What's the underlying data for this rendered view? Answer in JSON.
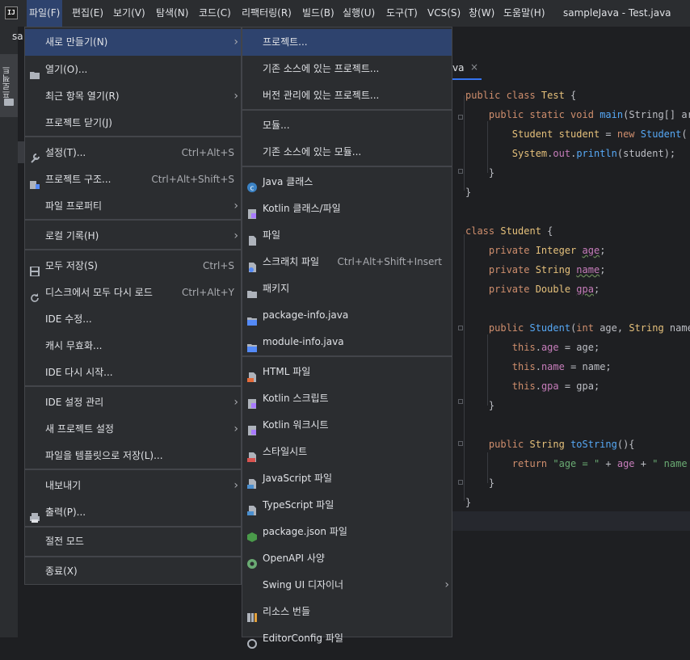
{
  "app_logo": "IJ",
  "menubar": [
    "파일(F)",
    "편집(E)",
    "보기(V)",
    "탐색(N)",
    "코드(C)",
    "리팩터링(R)",
    "빌드(B)",
    "실행(U)",
    "도구(T)",
    "VCS(S)",
    "창(W)",
    "도움말(H)"
  ],
  "window_title": "sampleJava - Test.java",
  "sidebar": {
    "stripe_label": "프로젝트",
    "project_name": "sa"
  },
  "editor_tab": {
    "label": "va",
    "close": "×"
  },
  "file_menu": [
    {
      "label": "새로 만들기(N)",
      "shortcut": "",
      "submenu": true,
      "icon": ""
    },
    {
      "label": "열기(O)...",
      "shortcut": "",
      "submenu": false,
      "icon": "folder-icon"
    },
    {
      "label": "최근 항목 열기(R)",
      "shortcut": "",
      "submenu": true,
      "icon": ""
    },
    {
      "label": "프로젝트 닫기(J)",
      "shortcut": "",
      "submenu": false,
      "icon": ""
    },
    {
      "label": "설정(T)...",
      "shortcut": "Ctrl+Alt+S",
      "submenu": false,
      "icon": "wrench-icon"
    },
    {
      "label": "프로젝트 구조...",
      "shortcut": "Ctrl+Alt+Shift+S",
      "submenu": false,
      "icon": "project-structure-icon"
    },
    {
      "label": "파일 프로퍼티",
      "shortcut": "",
      "submenu": true,
      "icon": ""
    },
    {
      "label": "로컬 기록(H)",
      "shortcut": "",
      "submenu": true,
      "icon": ""
    },
    {
      "label": "모두 저장(S)",
      "shortcut": "Ctrl+S",
      "submenu": false,
      "icon": "save-icon"
    },
    {
      "label": "디스크에서 모두 다시 로드",
      "shortcut": "Ctrl+Alt+Y",
      "submenu": false,
      "icon": "reload-icon"
    },
    {
      "label": "IDE 수정...",
      "shortcut": "",
      "submenu": false,
      "icon": ""
    },
    {
      "label": "캐시 무효화...",
      "shortcut": "",
      "submenu": false,
      "icon": ""
    },
    {
      "label": "IDE 다시 시작...",
      "shortcut": "",
      "submenu": false,
      "icon": ""
    },
    {
      "label": "IDE 설정 관리",
      "shortcut": "",
      "submenu": true,
      "icon": ""
    },
    {
      "label": "새 프로젝트 설정",
      "shortcut": "",
      "submenu": true,
      "icon": ""
    },
    {
      "label": "파일을 템플릿으로 저장(L)...",
      "shortcut": "",
      "submenu": false,
      "icon": ""
    },
    {
      "label": "내보내기",
      "shortcut": "",
      "submenu": true,
      "icon": ""
    },
    {
      "label": "출력(P)...",
      "shortcut": "",
      "submenu": false,
      "icon": "print-icon"
    },
    {
      "label": "절전 모드",
      "shortcut": "",
      "submenu": false,
      "icon": ""
    },
    {
      "label": "종료(X)",
      "shortcut": "",
      "submenu": false,
      "icon": ""
    }
  ],
  "new_menu": [
    {
      "label": "프로젝트...",
      "shortcut": "",
      "submenu": false,
      "icon": ""
    },
    {
      "label": "기존 소스에 있는 프로젝트...",
      "shortcut": "",
      "submenu": false,
      "icon": ""
    },
    {
      "label": "버전 관리에 있는 프로젝트...",
      "shortcut": "",
      "submenu": false,
      "icon": ""
    },
    {
      "label": "모듈...",
      "shortcut": "",
      "submenu": false,
      "icon": ""
    },
    {
      "label": "기존 소스에 있는 모듈...",
      "shortcut": "",
      "submenu": false,
      "icon": ""
    },
    {
      "label": "Java 클래스",
      "shortcut": "",
      "submenu": false,
      "icon": "java-class-icon"
    },
    {
      "label": "Kotlin 클래스/파일",
      "shortcut": "",
      "submenu": false,
      "icon": "kotlin-file-icon"
    },
    {
      "label": "파일",
      "shortcut": "",
      "submenu": false,
      "icon": "file-icon"
    },
    {
      "label": "스크래치 파일",
      "shortcut": "Ctrl+Alt+Shift+Insert",
      "submenu": false,
      "icon": "scratch-file-icon"
    },
    {
      "label": "패키지",
      "shortcut": "",
      "submenu": false,
      "icon": "package-folder-icon"
    },
    {
      "label": "package-info.java",
      "shortcut": "",
      "submenu": false,
      "icon": "package-info-icon"
    },
    {
      "label": "module-info.java",
      "shortcut": "",
      "submenu": false,
      "icon": "module-info-icon"
    },
    {
      "label": "HTML 파일",
      "shortcut": "",
      "submenu": false,
      "icon": "html-file-icon"
    },
    {
      "label": "Kotlin 스크립트",
      "shortcut": "",
      "submenu": false,
      "icon": "kotlin-script-icon"
    },
    {
      "label": "Kotlin 워크시트",
      "shortcut": "",
      "submenu": false,
      "icon": "kotlin-worksheet-icon"
    },
    {
      "label": "스타일시트",
      "shortcut": "",
      "submenu": false,
      "icon": "css-file-icon"
    },
    {
      "label": "JavaScript 파일",
      "shortcut": "",
      "submenu": false,
      "icon": "javascript-file-icon"
    },
    {
      "label": "TypeScript 파일",
      "shortcut": "",
      "submenu": false,
      "icon": "typescript-file-icon"
    },
    {
      "label": "package.json 파일",
      "shortcut": "",
      "submenu": false,
      "icon": "nodejs-icon"
    },
    {
      "label": "OpenAPI 사양",
      "shortcut": "",
      "submenu": false,
      "icon": "openapi-icon"
    },
    {
      "label": "Swing UI 디자이너",
      "shortcut": "",
      "submenu": true,
      "icon": ""
    },
    {
      "label": "리소스 번들",
      "shortcut": "",
      "submenu": false,
      "icon": "resource-bundle-icon"
    },
    {
      "label": "EditorConfig 파일",
      "shortcut": "",
      "submenu": false,
      "icon": "editorconfig-icon"
    }
  ],
  "code": [
    [
      [
        "public class ",
        "kw"
      ],
      [
        "Test",
        "id"
      ],
      [
        " {",
        "pl"
      ]
    ],
    [
      [
        "    "
      ],
      [
        "public static void ",
        "kw"
      ],
      [
        "main",
        "fn"
      ],
      [
        "(String[] ar",
        "pl"
      ]
    ],
    [
      [
        "        "
      ],
      [
        "Student ",
        "ty"
      ],
      [
        "student",
        "id"
      ],
      [
        " = ",
        "pl"
      ],
      [
        "new ",
        "kw"
      ],
      [
        "Student",
        "fn"
      ],
      [
        "( a",
        "pl"
      ]
    ],
    [
      [
        "        "
      ],
      [
        "System",
        "ty"
      ],
      [
        ".",
        "pl"
      ],
      [
        "out",
        "fld"
      ],
      [
        ".",
        "pl"
      ],
      [
        "println",
        "fn"
      ],
      [
        "(student);",
        "pl"
      ]
    ],
    [
      [
        "    }",
        "pl"
      ]
    ],
    [
      [
        "}",
        "pl"
      ]
    ],
    [
      [
        "",
        "pl"
      ]
    ],
    [
      [
        "class ",
        "kw"
      ],
      [
        "Student",
        "id"
      ],
      [
        " {",
        "pl"
      ]
    ],
    [
      [
        "    "
      ],
      [
        "private ",
        "kw"
      ],
      [
        "Integer ",
        "ty"
      ],
      [
        "age",
        "fldw"
      ],
      [
        ";",
        "pl"
      ]
    ],
    [
      [
        "    "
      ],
      [
        "private ",
        "kw"
      ],
      [
        "String ",
        "ty"
      ],
      [
        "name",
        "fldw"
      ],
      [
        ";",
        "pl"
      ]
    ],
    [
      [
        "    "
      ],
      [
        "private ",
        "kw"
      ],
      [
        "Double ",
        "ty"
      ],
      [
        "gpa",
        "fldw"
      ],
      [
        ";",
        "pl"
      ]
    ],
    [
      [
        "",
        "pl"
      ]
    ],
    [
      [
        "    "
      ],
      [
        "public ",
        "kw"
      ],
      [
        "Student",
        "fn"
      ],
      [
        "(",
        "pl"
      ],
      [
        "int ",
        "kw"
      ],
      [
        "age, ",
        "pl"
      ],
      [
        "String ",
        "ty"
      ],
      [
        "name,",
        "pl"
      ]
    ],
    [
      [
        "        "
      ],
      [
        "this",
        "kw"
      ],
      [
        ".",
        "pl"
      ],
      [
        "age",
        "fld"
      ],
      [
        " = age;",
        "pl"
      ]
    ],
    [
      [
        "        "
      ],
      [
        "this",
        "kw"
      ],
      [
        ".",
        "pl"
      ],
      [
        "name",
        "fld"
      ],
      [
        " = name;",
        "pl"
      ]
    ],
    [
      [
        "        "
      ],
      [
        "this",
        "kw"
      ],
      [
        ".",
        "pl"
      ],
      [
        "gpa",
        "fld"
      ],
      [
        " = gpa;",
        "pl"
      ]
    ],
    [
      [
        "    }",
        "pl"
      ]
    ],
    [
      [
        "",
        "pl"
      ]
    ],
    [
      [
        "    "
      ],
      [
        "public ",
        "kw"
      ],
      [
        "String ",
        "ty"
      ],
      [
        "toString",
        "fn"
      ],
      [
        "(){",
        "pl"
      ]
    ],
    [
      [
        "        "
      ],
      [
        "return ",
        "kw"
      ],
      [
        "\"age = \" ",
        "str"
      ],
      [
        "+ ",
        "pl"
      ],
      [
        "age",
        "fld"
      ],
      [
        " + ",
        "pl"
      ],
      [
        "\" name =",
        "str"
      ]
    ],
    [
      [
        "    }",
        "pl"
      ]
    ],
    [
      [
        "}",
        "pl"
      ]
    ]
  ],
  "colors": {
    "kw": "#cf8e6d",
    "id": "#e5c07b",
    "fn": "#56a8f5",
    "ty": "#e5c07b",
    "fld": "#c77dbb",
    "fldw": "#c77dbb",
    "str": "#6aab73",
    "pl": "#bcbec4",
    "selection": "#2e436e",
    "menu_bg": "#2b2d30"
  }
}
